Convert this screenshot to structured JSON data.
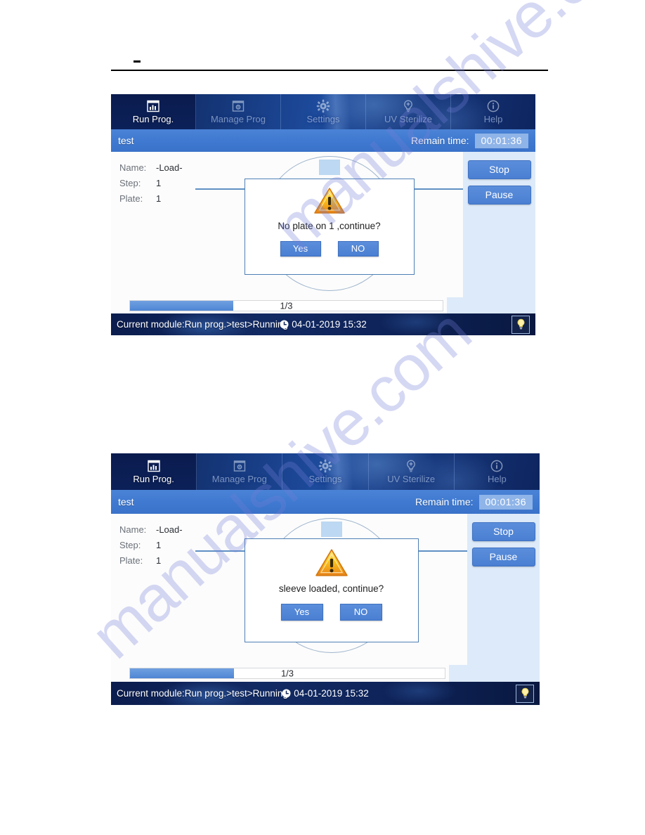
{
  "document": {
    "rule_mark": "-"
  },
  "watermark": {
    "text": "manualshive.com"
  },
  "nav": {
    "tabs": [
      {
        "label": "Run Prog.",
        "icon": "chart-bars-icon",
        "active": true
      },
      {
        "label": "Manage Prog",
        "icon": "window-gear-icon",
        "active": false
      },
      {
        "label": "Settings",
        "icon": "gear-icon",
        "active": false
      },
      {
        "label": "UV Sterilize",
        "icon": "uv-bulb-icon",
        "active": false
      },
      {
        "label": "Help",
        "icon": "info-circle-icon",
        "active": false
      }
    ]
  },
  "program_bar": {
    "program_name": "test",
    "remain_label": "Remain time:",
    "remain_value": "00:01:36"
  },
  "info_panel": {
    "rows": [
      {
        "key": "Name:",
        "value": "-Load-"
      },
      {
        "key": "Step:",
        "value": "1"
      },
      {
        "key": "Plate:",
        "value": "1"
      }
    ]
  },
  "side_buttons": [
    {
      "label": "Stop"
    },
    {
      "label": "Pause"
    }
  ],
  "dialog_1": {
    "message": "No plate on 1 ,continue?",
    "icon": "warning-triangle-icon",
    "yes_label": "Yes",
    "no_label": "NO"
  },
  "dialog_2": {
    "message": "sleeve loaded, continue?",
    "icon": "warning-triangle-icon",
    "yes_label": "Yes",
    "no_label": "NO"
  },
  "progress": {
    "text": "1/3",
    "percent": 33
  },
  "status_bar": {
    "module_text": "Current module:Run prog.>test>Running",
    "clock_icon": "clock-icon",
    "datetime": "04-01-2019 15:32",
    "bulb_icon": "light-bulb-icon"
  },
  "colors": {
    "nav_dark": "#0b1f57",
    "accent_blue": "#4a7fd2",
    "prog_bar_blue": "#3f79d0",
    "side_panel": "#ddeaf9",
    "warning_yellow": "#f5a81c",
    "watermark": "#747ed6"
  }
}
